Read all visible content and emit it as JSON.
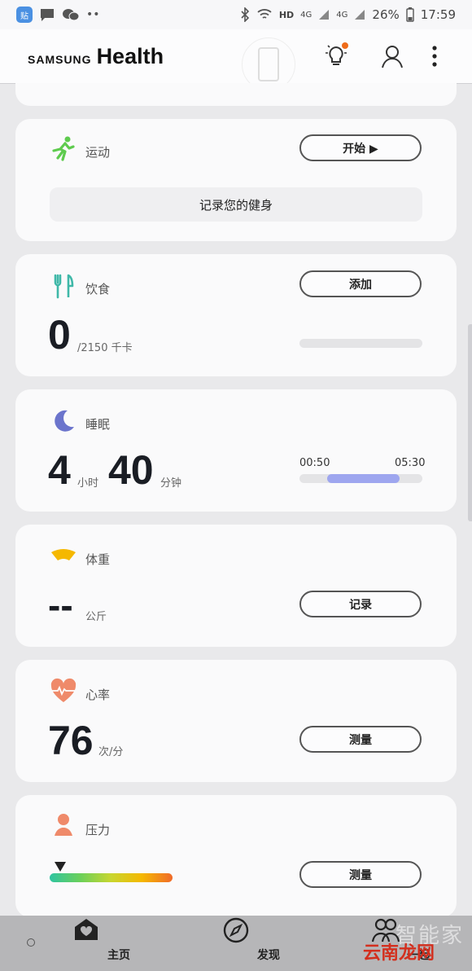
{
  "status_bar": {
    "left_icons": [
      "app-icon",
      "message-icon",
      "wechat-icon",
      "more-notifications-icon"
    ],
    "app_badge_text": "贴",
    "network": "HD",
    "signal1": "4G",
    "signal2": "4G",
    "battery": "26%",
    "time": "17:59"
  },
  "header": {
    "brand_samsung": "SAMSUNG",
    "brand_health": "Health",
    "notification_dot_color": "#ef6c1a"
  },
  "exercise": {
    "title": "运动",
    "start_label": "开始 ▶",
    "record_label": "记录您的健身",
    "icon_color": "#5ecb4e"
  },
  "food": {
    "title": "饮食",
    "add_label": "添加",
    "value": "0",
    "target": "/2150 千卡",
    "progress": 0,
    "icon_color": "#3fb8a8"
  },
  "sleep": {
    "title": "睡眠",
    "hours": "4",
    "hours_unit": "小时",
    "minutes": "40",
    "minutes_unit": "分钟",
    "start_time": "00:50",
    "end_time": "05:30",
    "bar_color": "#9ea6ef",
    "icon_color": "#6b74cc"
  },
  "weight": {
    "title": "体重",
    "value": "--",
    "unit": "公斤",
    "record_label": "记录",
    "icon_color": "#f5b800"
  },
  "heart": {
    "title": "心率",
    "value": "76",
    "unit": "次/分",
    "measure_label": "测量",
    "icon_color": "#ef8a6a"
  },
  "stress": {
    "title": "压力",
    "measure_label": "测量",
    "icon_color": "#ef8a6a"
  },
  "bottom_nav": {
    "home": "主页",
    "discover": "发现",
    "together": "一起"
  },
  "watermark": {
    "text1": "智能家",
    "text2": "云南龙网"
  }
}
